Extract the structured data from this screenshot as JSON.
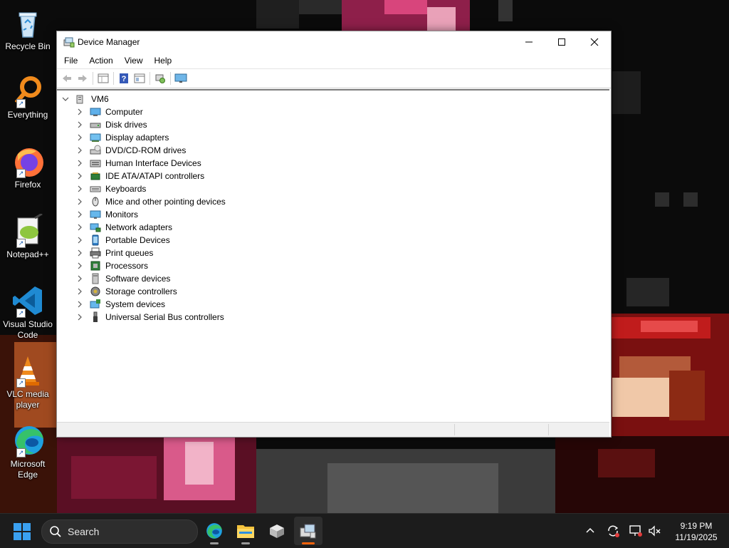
{
  "desktop": {
    "icons": [
      {
        "label": "Recycle Bin"
      },
      {
        "label": "Everything"
      },
      {
        "label": "Firefox"
      },
      {
        "label": "Notepad++"
      },
      {
        "label": "Visual Studio Code"
      },
      {
        "label": "VLC media player"
      },
      {
        "label": "Microsoft Edge"
      }
    ]
  },
  "window": {
    "title": "Device Manager",
    "menu": [
      "File",
      "Action",
      "View",
      "Help"
    ],
    "toolbar_icons": [
      "back-arrow-icon",
      "forward-arrow-icon",
      "properties-grid-icon",
      "help-icon",
      "show-hide-console-tree-icon",
      "scan-hardware-icon",
      "monitor-icon"
    ],
    "tree": {
      "root": "VM6",
      "items": [
        {
          "label": "Computer",
          "icon": "computer-icon"
        },
        {
          "label": "Disk drives",
          "icon": "disk-drive-icon"
        },
        {
          "label": "Display adapters",
          "icon": "display-adapter-icon"
        },
        {
          "label": "DVD/CD-ROM drives",
          "icon": "dvd-drive-icon"
        },
        {
          "label": "Human Interface Devices",
          "icon": "hid-icon"
        },
        {
          "label": "IDE ATA/ATAPI controllers",
          "icon": "ide-controller-icon"
        },
        {
          "label": "Keyboards",
          "icon": "keyboard-icon"
        },
        {
          "label": "Mice and other pointing devices",
          "icon": "mouse-icon"
        },
        {
          "label": "Monitors",
          "icon": "monitor-icon"
        },
        {
          "label": "Network adapters",
          "icon": "network-adapter-icon"
        },
        {
          "label": "Portable Devices",
          "icon": "portable-device-icon"
        },
        {
          "label": "Print queues",
          "icon": "printer-icon"
        },
        {
          "label": "Processors",
          "icon": "processor-icon"
        },
        {
          "label": "Software devices",
          "icon": "software-device-icon"
        },
        {
          "label": "Storage controllers",
          "icon": "storage-controller-icon"
        },
        {
          "label": "System devices",
          "icon": "system-device-icon"
        },
        {
          "label": "Universal Serial Bus controllers",
          "icon": "usb-icon"
        }
      ]
    }
  },
  "taskbar": {
    "search_placeholder": "Search",
    "apps": [
      "edge-icon",
      "file-explorer-icon",
      "package-installer-icon",
      "device-manager-icon"
    ],
    "tray_icons": [
      "chevron-up-icon",
      "sync-icon",
      "network-icon",
      "volume-muted-icon"
    ],
    "time": "9:19 PM",
    "date": "11/19/2025"
  },
  "colors": {
    "taskbar_bg": "#1c1c1c",
    "active_indicator": "#f7630c",
    "window_bg": "#ffffff",
    "statusbar_bg": "#f0f0f0"
  }
}
